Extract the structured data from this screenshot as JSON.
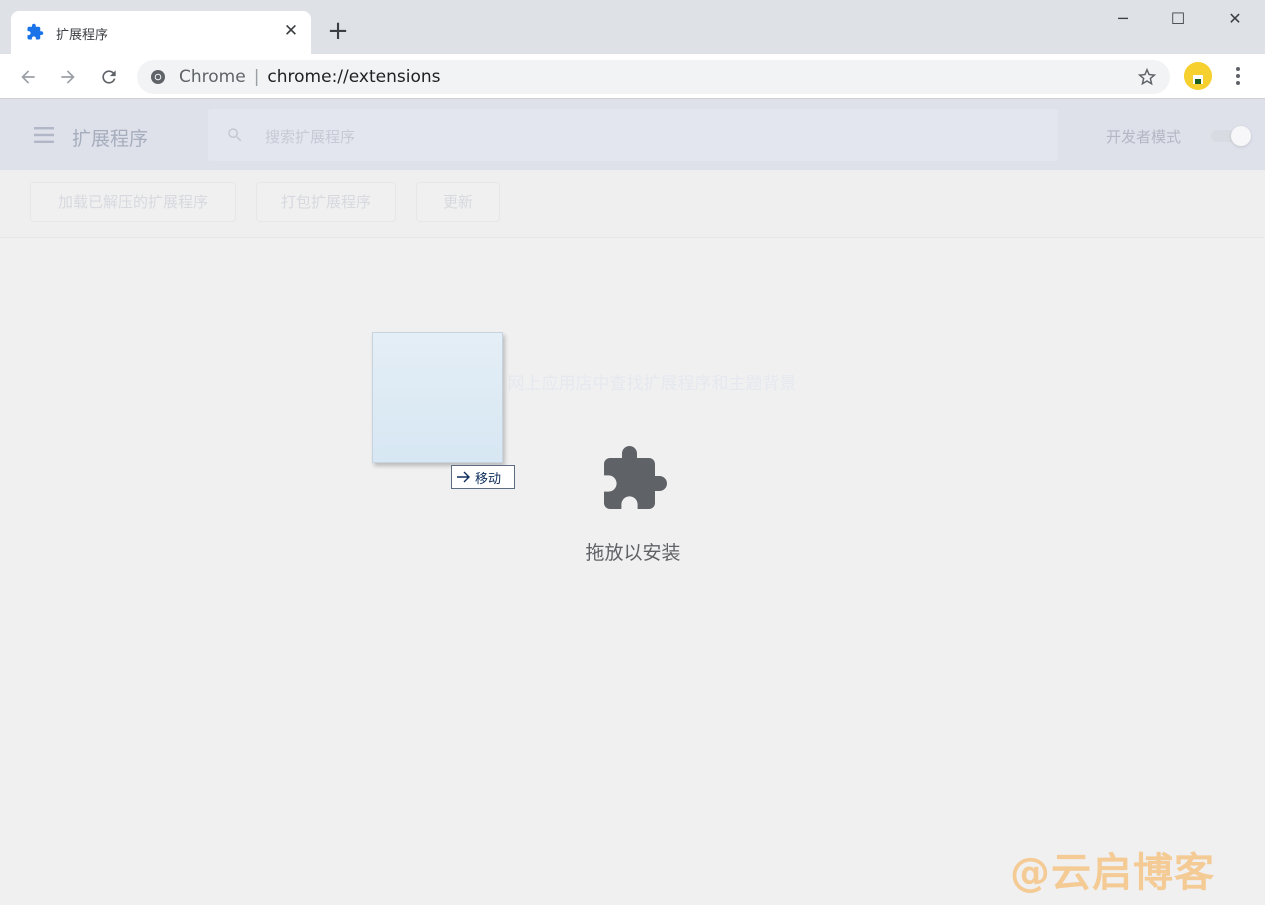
{
  "tab": {
    "title": "扩展程序",
    "icon": "puzzle-icon"
  },
  "window_controls": [
    "minimize-icon",
    "maximize-icon",
    "close-icon"
  ],
  "omnibox": {
    "site": "Chrome",
    "url": "chrome://extensions"
  },
  "extensions_page": {
    "title": "扩展程序",
    "search_placeholder": "搜索扩展程序",
    "developer_mode_label": "开发者模式",
    "developer_mode_on": true,
    "actions": [
      "加载已解压的扩展程序",
      "打包扩展程序",
      "更新"
    ],
    "webstore_link": "在 Chrome 网上应用店中查找扩展程序和主题背景"
  },
  "drag_overlay": {
    "tooltip": "移动",
    "drop_text": "拖放以安装"
  },
  "watermark": "@云启博客",
  "colors": {
    "accent": "#1a73e8",
    "avatar": "#f6d02f",
    "drop_icon": "#5f6368",
    "watermark": "#f5c68c"
  }
}
